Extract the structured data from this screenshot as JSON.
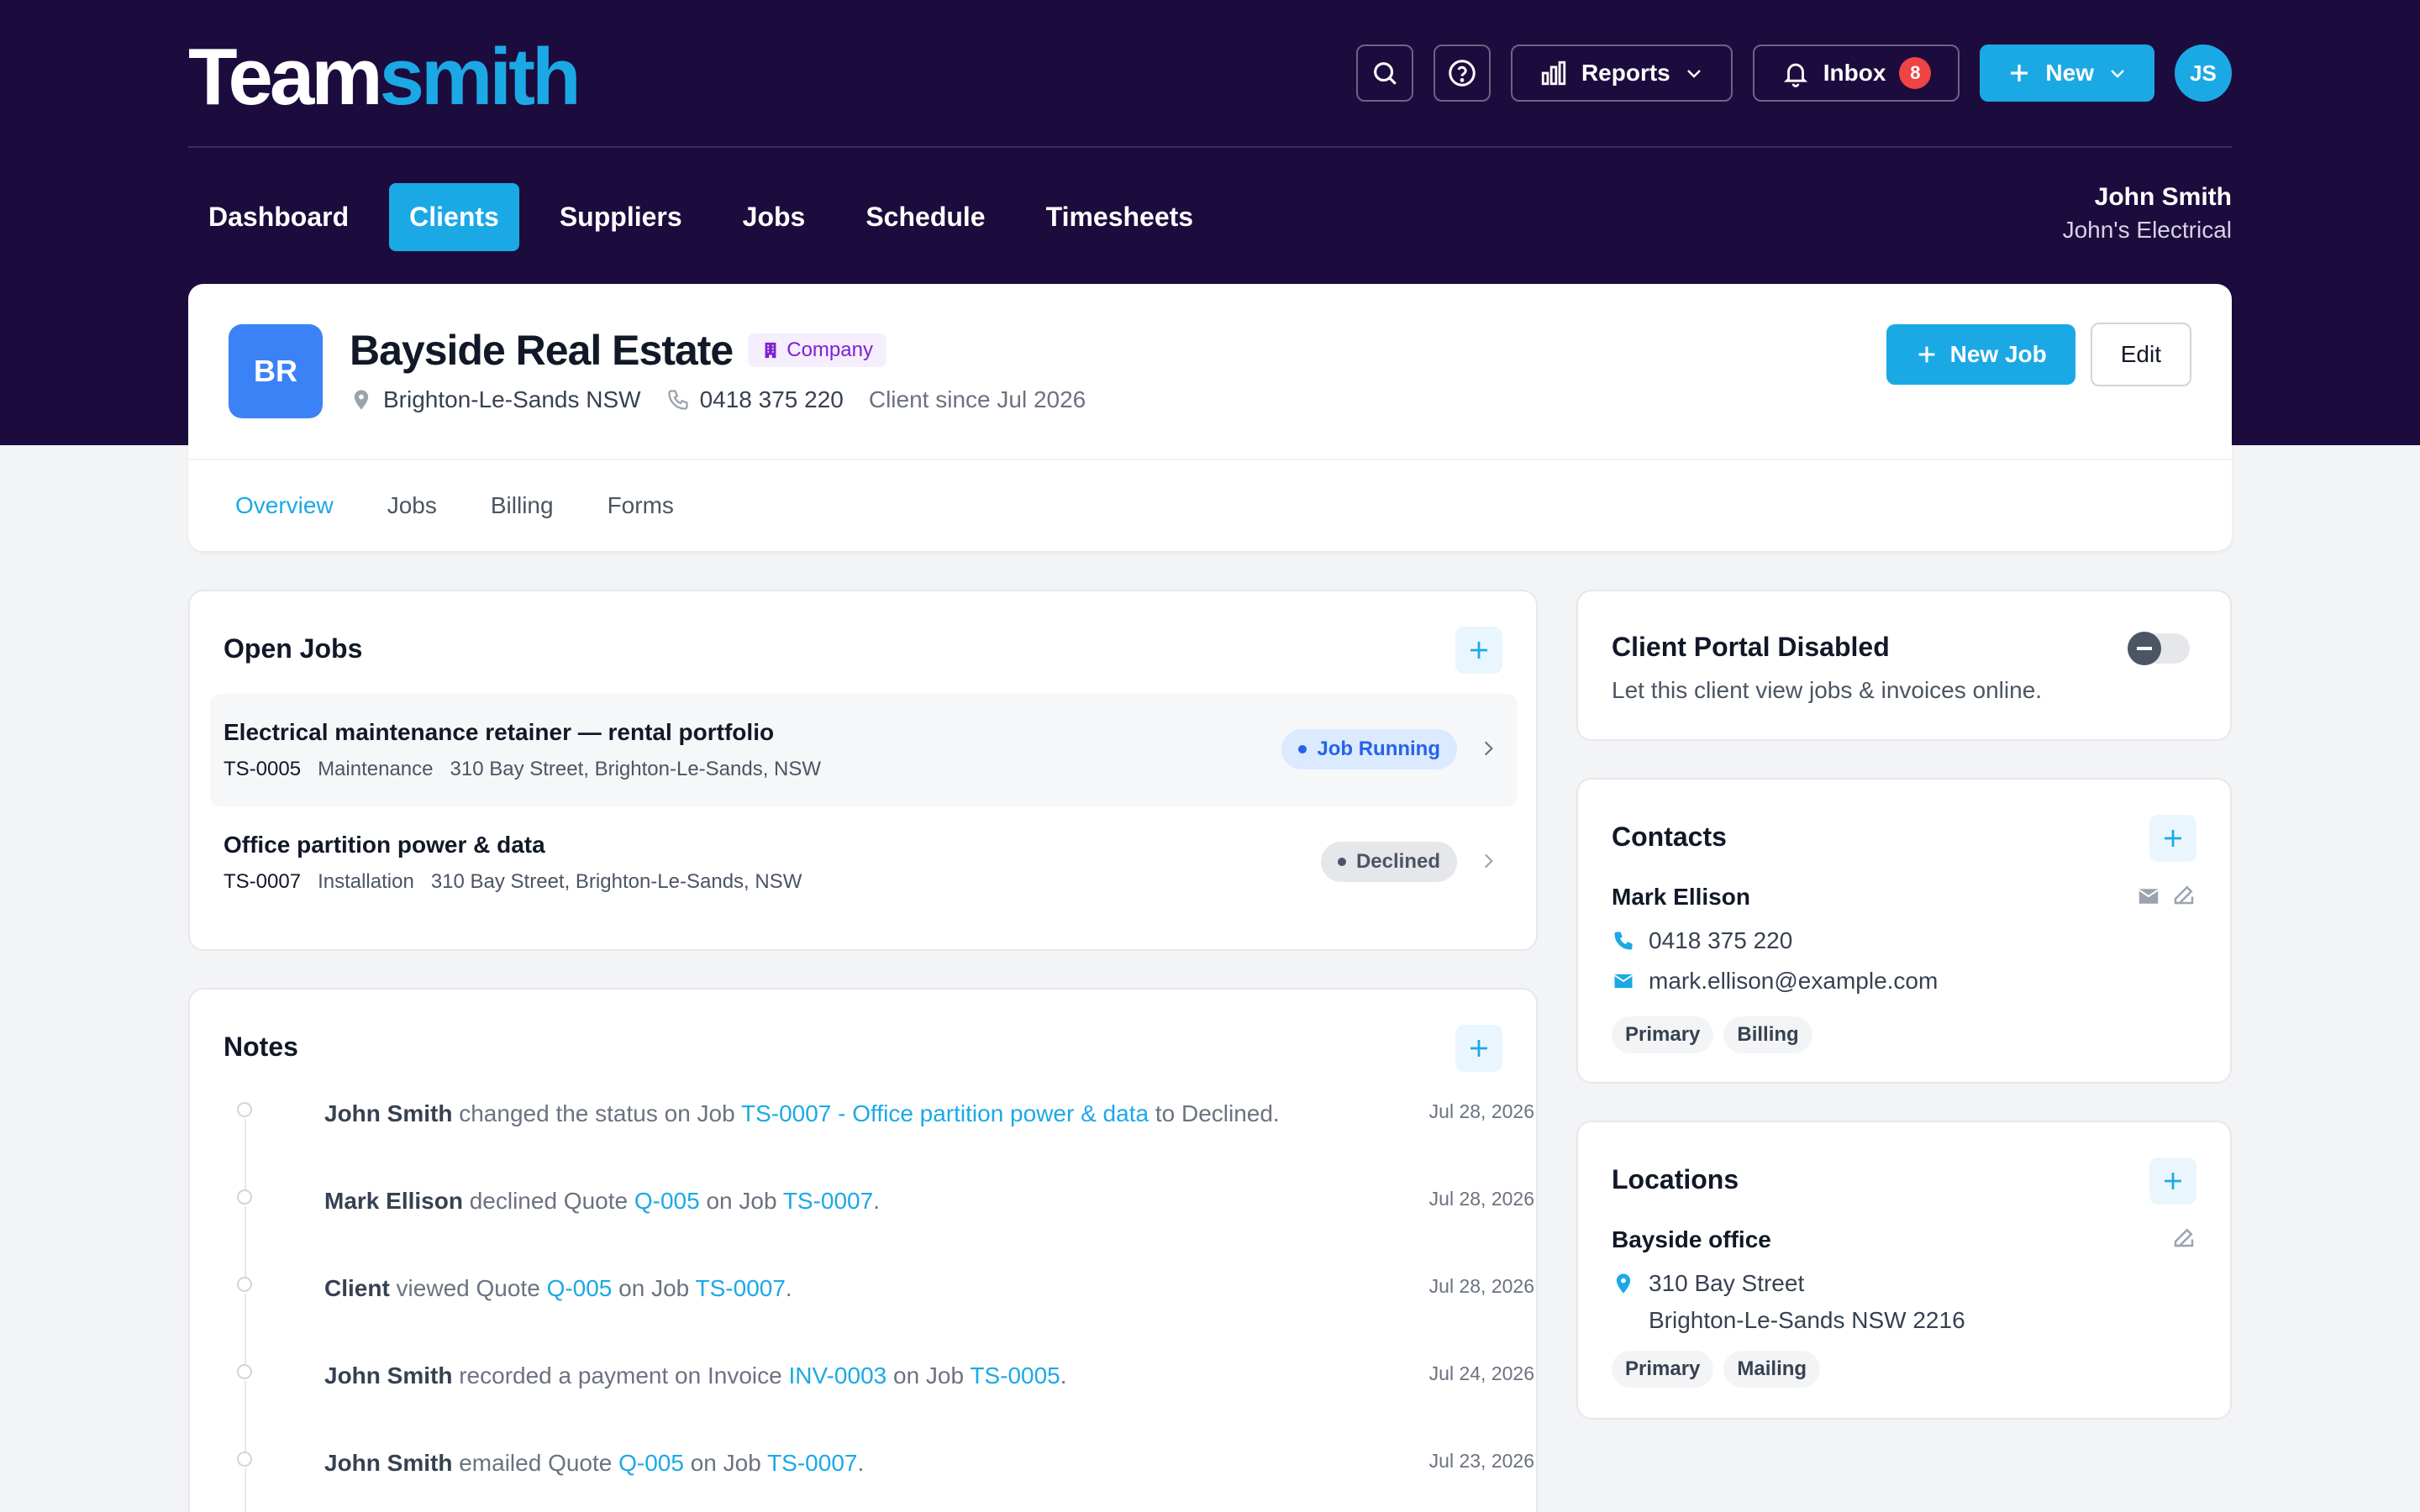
{
  "app": {
    "logo_part1": "Team",
    "logo_part2": "smith"
  },
  "header": {
    "reports_label": "Reports",
    "inbox_label": "Inbox",
    "inbox_count": "8",
    "new_label": "New",
    "avatar_initials": "JS"
  },
  "nav": {
    "items": [
      "Dashboard",
      "Clients",
      "Suppliers",
      "Jobs",
      "Schedule",
      "Timesheets"
    ],
    "active": "Clients",
    "user_name": "John Smith",
    "user_company": "John's Electrical"
  },
  "client": {
    "initials": "BR",
    "name": "Bayside Real Estate",
    "type_badge": "Company",
    "location": "Brighton-Le-Sands NSW",
    "phone": "0418 375 220",
    "since": "Client since Jul 2026",
    "new_job_label": "New Job",
    "edit_label": "Edit",
    "tabs": [
      "Overview",
      "Jobs",
      "Billing",
      "Forms"
    ],
    "active_tab": "Overview"
  },
  "open_jobs": {
    "title": "Open Jobs",
    "jobs": [
      {
        "title": "Electrical maintenance retainer — rental portfolio",
        "number": "TS-0005",
        "type": "Maintenance",
        "address": "310 Bay Street, Brighton-Le-Sands, NSW",
        "status": "Job Running"
      },
      {
        "title": "Office partition power & data",
        "number": "TS-0007",
        "type": "Installation",
        "address": "310 Bay Street, Brighton-Le-Sands, NSW",
        "status": "Declined"
      }
    ]
  },
  "notes": {
    "title": "Notes",
    "items": [
      {
        "actor": "John Smith",
        "t1": " changed the status on Job ",
        "l1": "TS-0007 - Office partition power & data",
        "t2": " to Declined.",
        "l2": "",
        "t3": "",
        "date": "Jul 28, 2026"
      },
      {
        "actor": "Mark Ellison",
        "t1": " declined Quote ",
        "l1": "Q-005",
        "t2": " on Job ",
        "l2": "TS-0007",
        "t3": ".",
        "date": "Jul 28, 2026"
      },
      {
        "actor": "Client",
        "t1": " viewed Quote ",
        "l1": "Q-005",
        "t2": " on Job ",
        "l2": "TS-0007",
        "t3": ".",
        "date": "Jul 28, 2026"
      },
      {
        "actor": "John Smith",
        "t1": " recorded a payment on Invoice ",
        "l1": "INV-0003",
        "t2": " on Job ",
        "l2": "TS-0005",
        "t3": ".",
        "date": "Jul 24, 2026"
      },
      {
        "actor": "John Smith",
        "t1": " emailed Quote ",
        "l1": "Q-005",
        "t2": " on Job ",
        "l2": "TS-0007",
        "t3": ".",
        "date": "Jul 23, 2026"
      }
    ]
  },
  "portal": {
    "title": "Client Portal Disabled",
    "description": "Let this client view jobs & invoices online.",
    "enabled": false
  },
  "contacts": {
    "title": "Contacts",
    "name": "Mark Ellison",
    "phone": "0418 375 220",
    "email": "mark.ellison@example.com",
    "tags": [
      "Primary",
      "Billing"
    ]
  },
  "locations": {
    "title": "Locations",
    "name": "Bayside office",
    "address_line1": "310 Bay Street",
    "address_line2": "Brighton-Le-Sands NSW 2216",
    "tags": [
      "Primary",
      "Mailing"
    ]
  },
  "colors": {
    "brand_dark": "#1c0c3d",
    "accent": "#1ba9e6",
    "badge_red": "#ef4444",
    "company_purple": "#7e22ce"
  }
}
